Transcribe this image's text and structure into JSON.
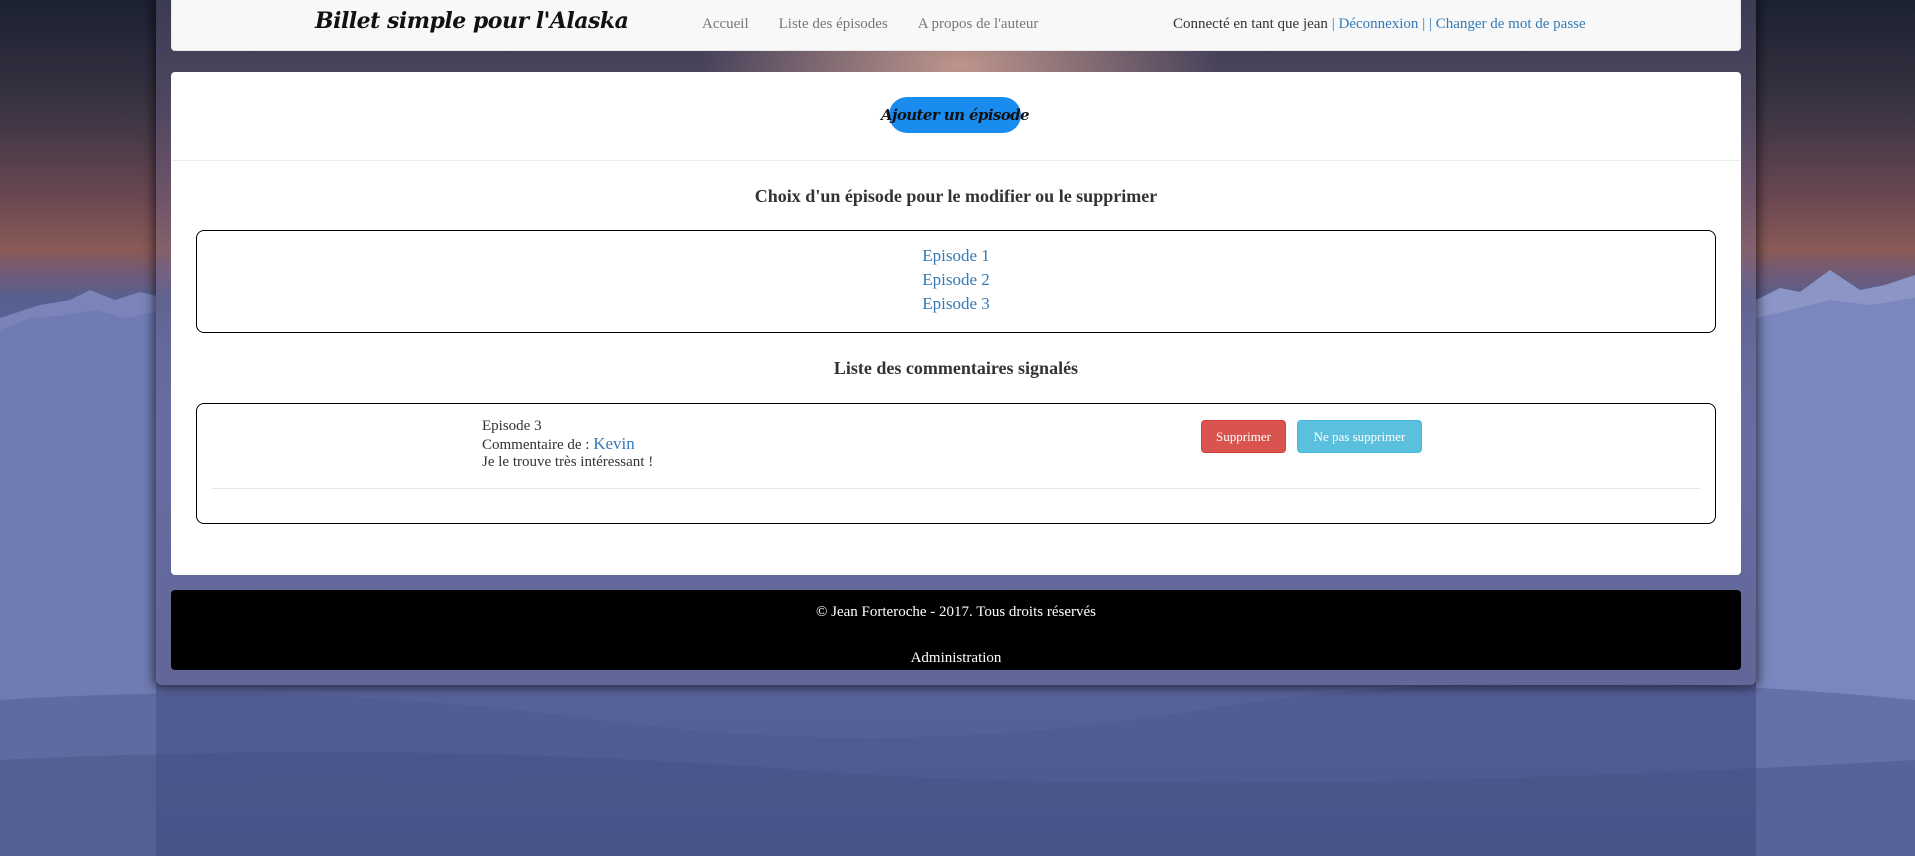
{
  "navbar": {
    "brand": "Billet simple pour l'Alaska",
    "links": [
      "Accueil",
      "Liste des épisodes",
      "A propos de l'auteur"
    ],
    "user": {
      "logged_in_text": "Connecté en tant que jean",
      "logout": "Déconnexion",
      "change_password": "Changer de mot de passe"
    }
  },
  "main": {
    "add_episode_button": "Ajouter un épisode",
    "episodes_title": "Choix d'un épisode pour le modifier ou le supprimer",
    "episodes": [
      "Episode 1",
      "Episode 2",
      "Episode 3"
    ],
    "comments_title": "Liste des commentaires signalés",
    "reported_comments": [
      {
        "episode": "Episode 3",
        "author_prefix": "Commentaire de :",
        "author": "Kevin",
        "text": "Je le trouve très intéressant !",
        "delete_label": "Supprimer",
        "keep_label": "Ne pas supprimer"
      }
    ]
  },
  "footer": {
    "copyright": "© Jean Forteroche - 2017. Tous droits réservés",
    "admin_link": "Administration"
  },
  "colors": {
    "link": "#337ab7",
    "add_button": "#1a8cf0",
    "danger": "#d9534f",
    "info": "#5bc0de",
    "footer_bg": "#000000"
  }
}
